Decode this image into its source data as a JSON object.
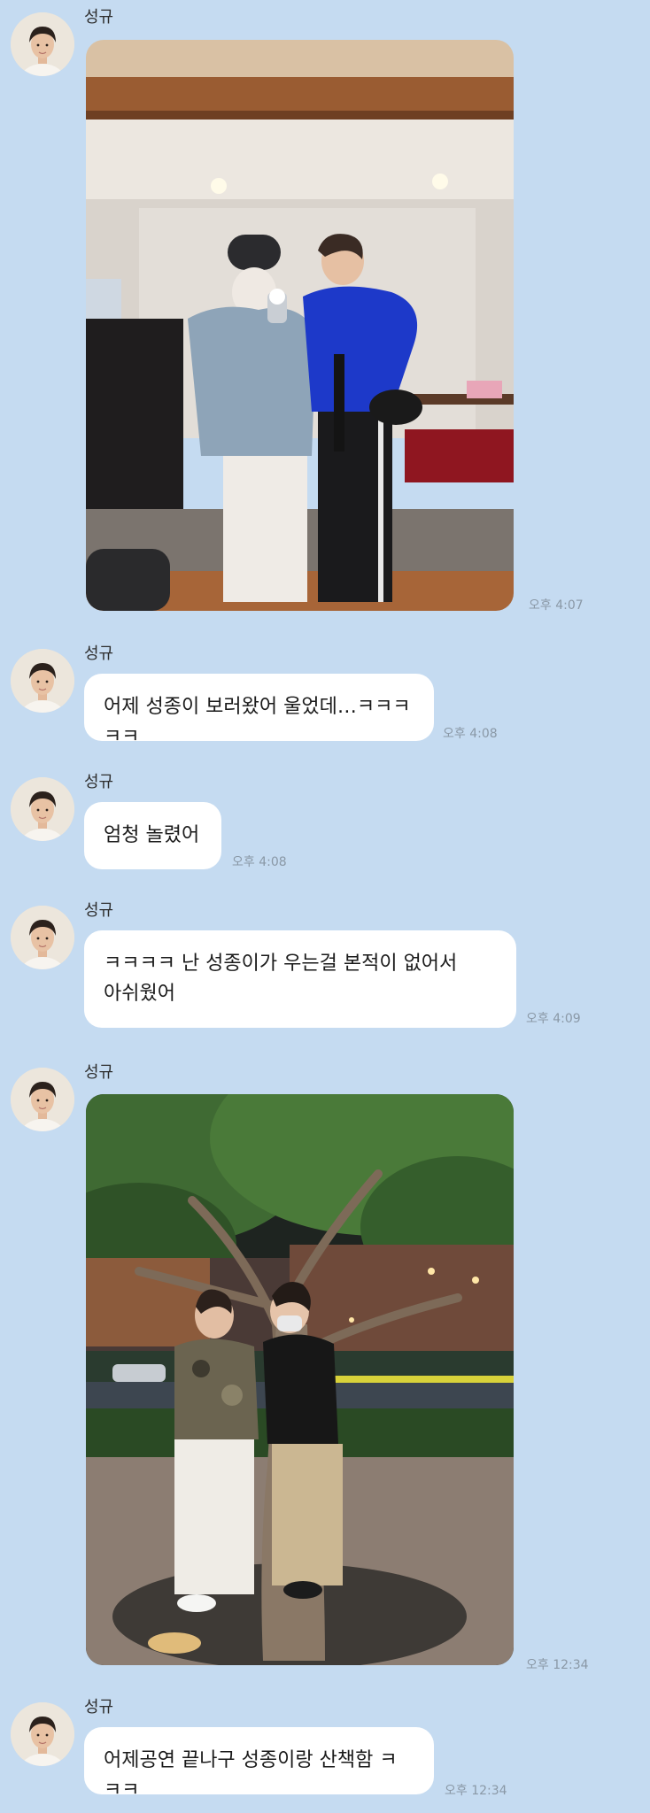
{
  "sender_name": "성규",
  "messages": [
    {
      "type": "image",
      "image_desc": "two-people-mirror-selfie-photo",
      "time": "오후 4:07"
    },
    {
      "type": "text",
      "text": "어제 성종이 보러왔어 울었데…ㅋㅋㅋㅋㅋ",
      "time": "오후 4:08"
    },
    {
      "type": "text",
      "text": "엄청 놀렸어",
      "time": "오후 4:08"
    },
    {
      "type": "text",
      "text": "ㅋㅋㅋㅋ 난 성종이가 우는걸 본적이 없어서\n아쉬웠어",
      "time": "오후 4:09"
    },
    {
      "type": "image",
      "image_desc": "two-people-hugging-tree-night-photo",
      "time": "오후 12:34"
    },
    {
      "type": "text",
      "text": "어제공연 끝나구 성종이랑 산책함 ㅋㅋㅋ",
      "time": "오후 12:34"
    }
  ]
}
